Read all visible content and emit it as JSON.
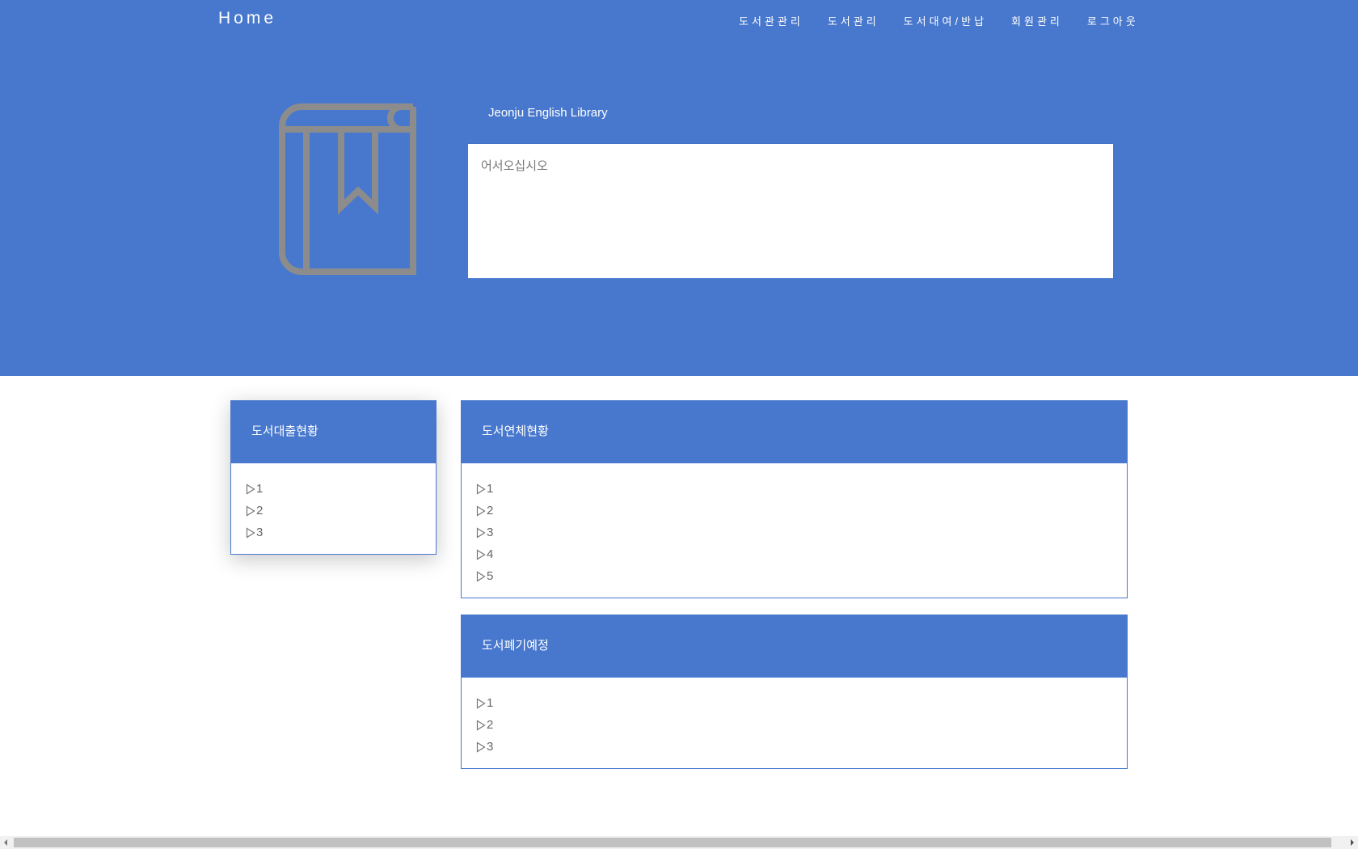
{
  "header": {
    "brand": "Home",
    "nav": [
      "도서관관리",
      "도서관리",
      "도서대여/반납",
      "회원관리",
      "로그아웃"
    ]
  },
  "hero": {
    "icon": "book-bookmark-icon",
    "card_title": "Jeonju English Library",
    "card_text": "어서오십시오"
  },
  "panels": {
    "loans": {
      "title": "도서대출현황",
      "items": [
        "1",
        "2",
        "3"
      ]
    },
    "overdue": {
      "title": "도서연체현황",
      "items": [
        "1",
        "2",
        "3",
        "4",
        "5"
      ]
    },
    "disposal": {
      "title": "도서폐기예정",
      "items": [
        "1",
        "2",
        "3"
      ]
    }
  },
  "colors": {
    "primary": "#4878cd",
    "icon_gray": "#8c8c8c",
    "text": "#666666"
  }
}
